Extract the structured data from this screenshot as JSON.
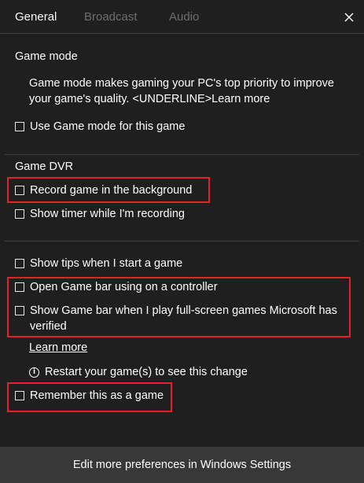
{
  "tabs": [
    {
      "label": "General",
      "active": true
    },
    {
      "label": "Broadcast",
      "active": false
    },
    {
      "label": "Audio",
      "active": false
    }
  ],
  "close_icon": "close-icon",
  "game_mode": {
    "heading": "Game mode",
    "description": "Game mode makes gaming your PC's top priority to improve your game's quality. <UNDERLINE>Learn more",
    "checkbox_label": "Use Game mode for this game",
    "checked": false
  },
  "game_dvr": {
    "heading": "Game DVR",
    "record_label": "Record game in the background",
    "timer_label": "Show timer while I'm recording"
  },
  "general": {
    "tips_label": "Show tips when I start a game",
    "open_bar_label": "Open Game bar using  on a controller",
    "fullscreen_label": "Show Game bar when I play full-screen games Microsoft has verified",
    "learn_more": "Learn more",
    "restart_info": "Restart your game(s) to see this change",
    "remember_label": "Remember this as a game"
  },
  "footer": {
    "label": "Edit more preferences in Windows Settings"
  },
  "colors": {
    "background": "#1f1f1f",
    "footer_bg": "#383838",
    "highlight": "#e4202a",
    "inactive_tab": "#6e6e6e"
  }
}
